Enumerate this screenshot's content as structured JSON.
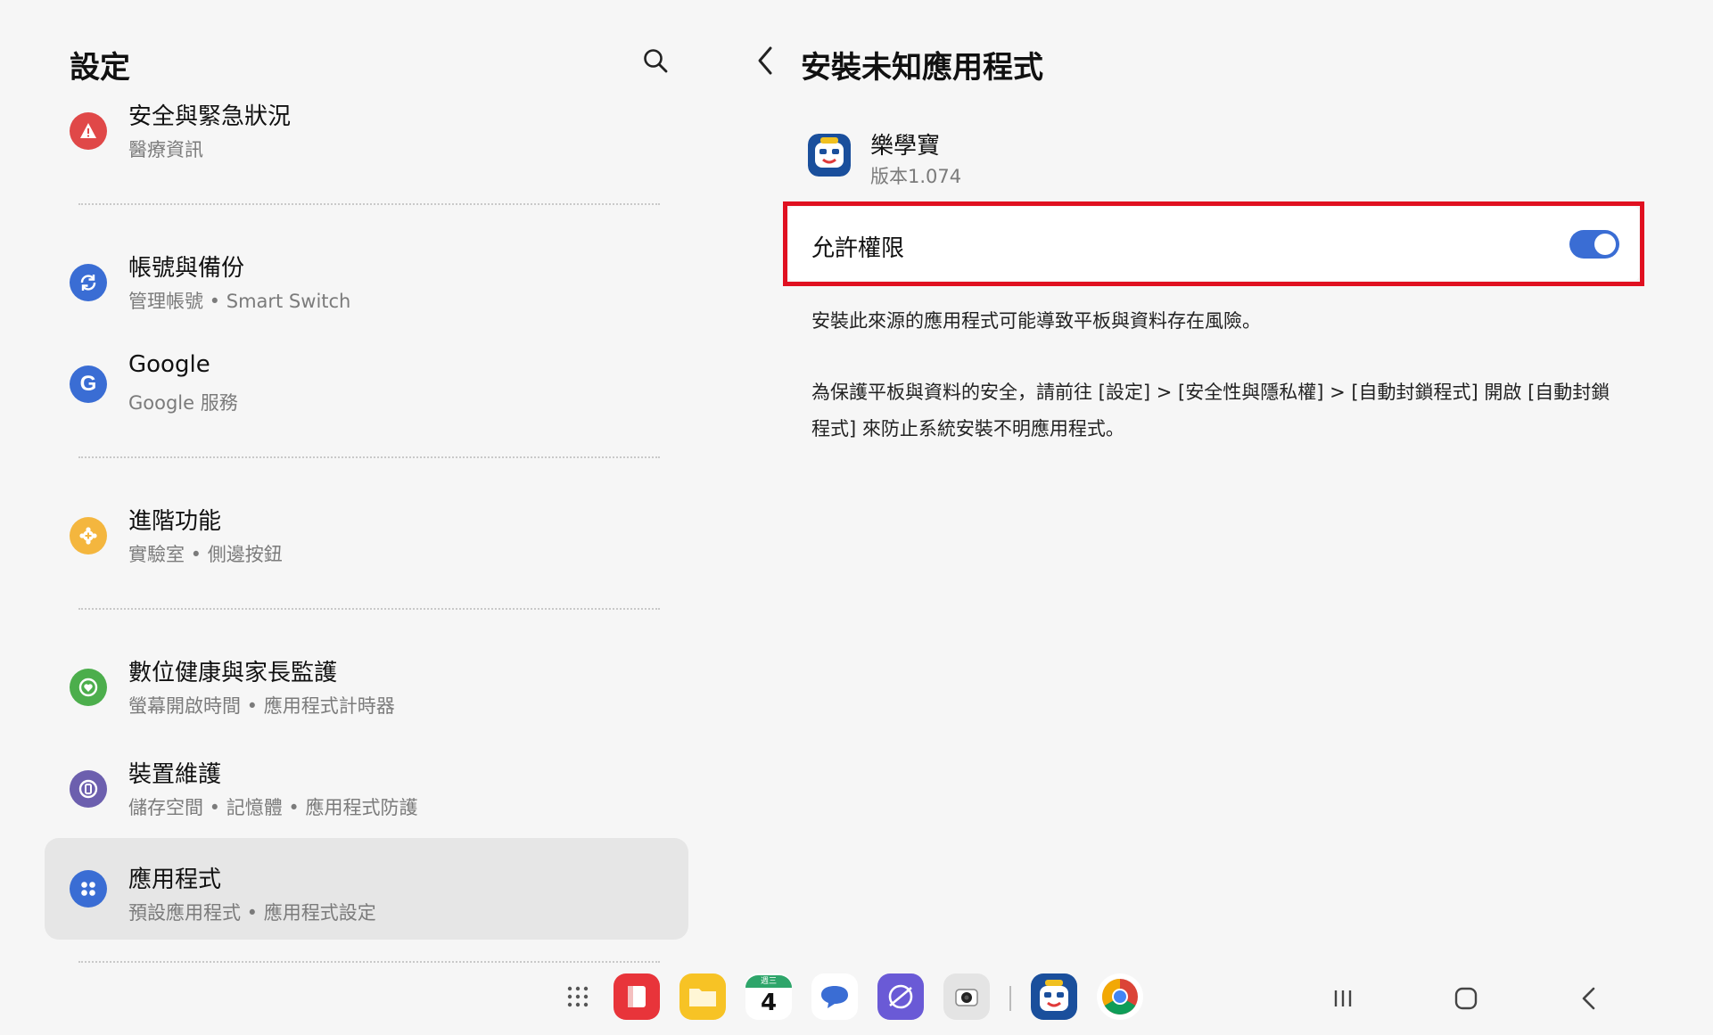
{
  "left_pane": {
    "title": "設定",
    "menu_items": [
      {
        "title": "安全與緊急狀況",
        "subtitle": "醫療資訊",
        "icon": "alert-icon",
        "color": "#e04848"
      },
      {
        "title": "帳號與備份",
        "subtitle": "管理帳號 • Smart Switch",
        "icon": "sync-icon",
        "color": "#3a6dd4"
      },
      {
        "title": "Google",
        "subtitle": "Google 服務",
        "icon": "google-icon",
        "color": "#3a6dd4"
      },
      {
        "title": "進階功能",
        "subtitle": "實驗室 • 側邊按鈕",
        "icon": "gear-plus-icon",
        "color": "#f4b63e"
      },
      {
        "title": "數位健康與家長監護",
        "subtitle": "螢幕開啟時間 • 應用程式計時器",
        "icon": "heart-ring-icon",
        "color": "#4cae4c"
      },
      {
        "title": "裝置維護",
        "subtitle": "儲存空間 • 記憶體 • 應用程式防護",
        "icon": "device-care-icon",
        "color": "#6c5fae"
      },
      {
        "title": "應用程式",
        "subtitle": "預設應用程式 • 應用程式設定",
        "icon": "apps-grid-icon",
        "color": "#3a6dd4",
        "selected": true
      }
    ]
  },
  "right_pane": {
    "title": "安裝未知應用程式",
    "app": {
      "name": "樂學寶",
      "version": "版本1.074"
    },
    "permission": {
      "label": "允許權限",
      "enabled": true
    },
    "description_1": "安裝此來源的應用程式可能導致平板與資料存在風險。",
    "description_2": "為保護平板與資料的安全，請前往 [設定] > [安全性與隱私權] > [自動封鎖程式] 開啟 [自動封鎖程式] 來防止系統安裝不明應用程式。"
  },
  "taskbar": {
    "calendar_day": "4",
    "calendar_weekday": "週三",
    "dock_apps": [
      "apps-drawer-icon",
      "notes-app-icon",
      "my-files-icon",
      "calendar-icon",
      "messages-icon",
      "internet-icon",
      "camera-icon",
      "lexuebao-app-icon",
      "chrome-icon"
    ],
    "nav_buttons": [
      "recents-button",
      "home-button",
      "back-button"
    ]
  },
  "colors": {
    "accent": "#3a6dd4",
    "highlight": "#e01020",
    "background": "#f6f6f6"
  }
}
